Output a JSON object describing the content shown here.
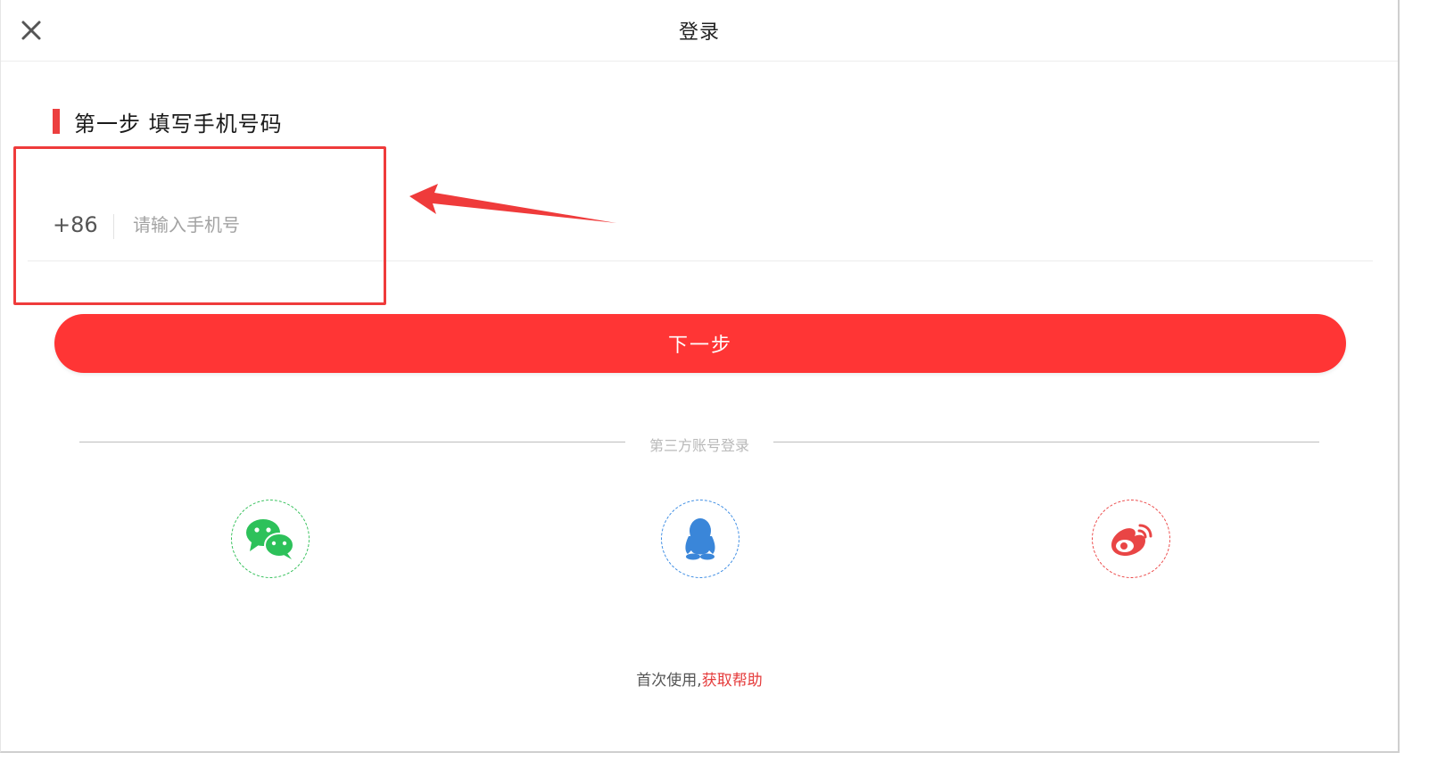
{
  "window": {
    "title": "登录"
  },
  "step": {
    "heading": "第一步 填写手机号码"
  },
  "phone": {
    "country_code": "+86",
    "value": "",
    "placeholder": "请输入手机号"
  },
  "next_button": {
    "label": "下一步"
  },
  "third_party": {
    "separator_text": "第三方账号登录",
    "providers": [
      {
        "name": "wechat",
        "icon": "wechat-icon",
        "color": "#2dc15a"
      },
      {
        "name": "qq",
        "icon": "qq-icon",
        "color": "#3a86d9"
      },
      {
        "name": "weibo",
        "icon": "weibo-icon",
        "color": "#e94545"
      }
    ]
  },
  "help": {
    "prefix": "首次使用,",
    "link_text": "获取帮助"
  },
  "colors": {
    "accent": "#ff3535",
    "annotation": "#ef3b3b"
  }
}
